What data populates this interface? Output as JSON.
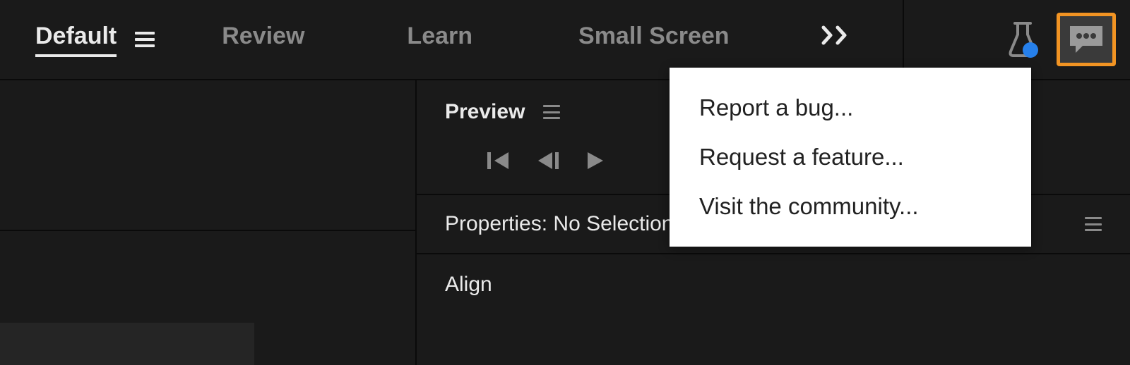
{
  "workspaces": {
    "default": "Default",
    "review": "Review",
    "learn": "Learn",
    "small_screen": "Small Screen"
  },
  "panels": {
    "preview": "Preview",
    "properties": "Properties: No Selection",
    "align": "Align"
  },
  "feedback_menu": {
    "report_bug": "Report a bug...",
    "request_feature": "Request a feature...",
    "visit_community": "Visit the community..."
  }
}
